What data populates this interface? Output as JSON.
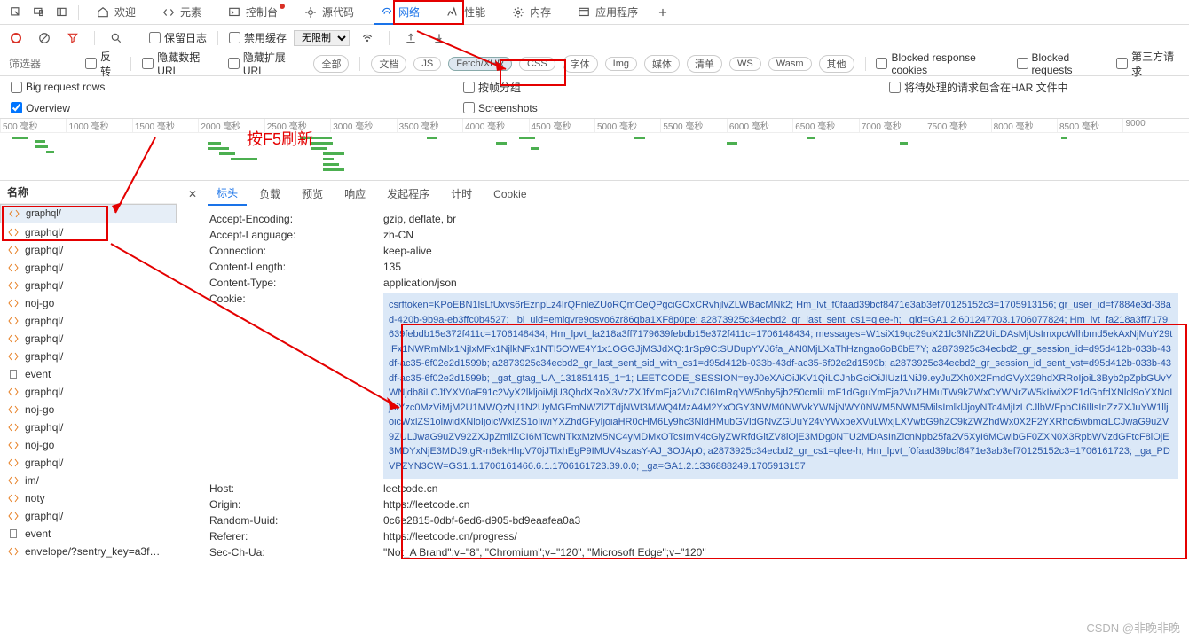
{
  "top_tabs": {
    "welcome": "欢迎",
    "elements": "元素",
    "console": "控制台",
    "sources": "源代码",
    "network": "网络",
    "performance": "性能",
    "memory": "内存",
    "application": "应用程序"
  },
  "toolbar2": {
    "preserve_log": "保留日志",
    "disable_cache": "禁用缓存",
    "throttle": "无限制"
  },
  "filter": {
    "placeholder": "筛选器",
    "invert": "反转",
    "hide_data_urls": "隐藏数据 URL",
    "hide_ext_urls": "隐藏扩展 URL",
    "pills": {
      "all": "全部",
      "doc": "文档",
      "js": "JS",
      "fetch": "Fetch/XHR",
      "css": "CSS",
      "font": "字体",
      "img": "Img",
      "media": "媒体",
      "manifest": "清单",
      "ws": "WS",
      "wasm": "Wasm",
      "other": "其他"
    },
    "blocked_cookies": "Blocked response cookies",
    "blocked_requests": "Blocked requests",
    "third_party": "第三方请求"
  },
  "options": {
    "big_rows": "Big request rows",
    "frame_group": "按帧分组",
    "overview": "Overview",
    "screenshots": "Screenshots",
    "har_pending": "将待处理的请求包含在HAR 文件中"
  },
  "timeline_ticks": [
    "500 毫秒",
    "1000 毫秒",
    "1500 毫秒",
    "2000 毫秒",
    "2500 毫秒",
    "3000 毫秒",
    "3500 毫秒",
    "4000 毫秒",
    "4500 毫秒",
    "5000 毫秒",
    "5500 毫秒",
    "6000 毫秒",
    "6500 毫秒",
    "7000 毫秒",
    "7500 毫秒",
    "8000 毫秒",
    "8500 毫秒",
    "9000"
  ],
  "req_list": {
    "header": "名称",
    "items": [
      {
        "label": "graphql/",
        "type": "xhr"
      },
      {
        "label": "graphql/",
        "type": "xhr"
      },
      {
        "label": "graphql/",
        "type": "xhr"
      },
      {
        "label": "graphql/",
        "type": "xhr"
      },
      {
        "label": "graphql/",
        "type": "xhr"
      },
      {
        "label": "noj-go",
        "type": "xhr"
      },
      {
        "label": "graphql/",
        "type": "xhr"
      },
      {
        "label": "graphql/",
        "type": "xhr"
      },
      {
        "label": "graphql/",
        "type": "xhr"
      },
      {
        "label": "event",
        "type": "doc"
      },
      {
        "label": "graphql/",
        "type": "xhr"
      },
      {
        "label": "noj-go",
        "type": "xhr"
      },
      {
        "label": "graphql/",
        "type": "xhr"
      },
      {
        "label": "noj-go",
        "type": "xhr"
      },
      {
        "label": "graphql/",
        "type": "xhr"
      },
      {
        "label": "im/",
        "type": "xhr"
      },
      {
        "label": "noty",
        "type": "xhr"
      },
      {
        "label": "graphql/",
        "type": "xhr"
      },
      {
        "label": "event",
        "type": "doc"
      },
      {
        "label": "envelope/?sentry_key=a3f…",
        "type": "xhr"
      }
    ]
  },
  "detail_tabs": {
    "headers": "标头",
    "payload": "负载",
    "preview": "预览",
    "response": "响应",
    "initiator": "发起程序",
    "timing": "计时",
    "cookies": "Cookie"
  },
  "headers": [
    {
      "k": "Accept-Encoding:",
      "v": "gzip, deflate, br"
    },
    {
      "k": "Accept-Language:",
      "v": "zh-CN"
    },
    {
      "k": "Connection:",
      "v": "keep-alive"
    },
    {
      "k": "Content-Length:",
      "v": "135"
    },
    {
      "k": "Content-Type:",
      "v": "application/json"
    },
    {
      "k": "Cookie:",
      "v": ""
    },
    {
      "k": "Host:",
      "v": "leetcode.cn"
    },
    {
      "k": "Origin:",
      "v": "https://leetcode.cn"
    },
    {
      "k": "Random-Uuid:",
      "v": "0c6e2815-0dbf-6ed6-d905-bd9eaafea0a3"
    },
    {
      "k": "Referer:",
      "v": "https://leetcode.cn/progress/"
    },
    {
      "k": "Sec-Ch-Ua:",
      "v": "\"Not_A Brand\";v=\"8\", \"Chromium\";v=\"120\", \"Microsoft Edge\";v=\"120\""
    }
  ],
  "cookie_value": "csrftoken=KPoEBN1lsLfUxvs6rEznpLz4IrQFnleZUoRQmOeQPgciGOxCRvhjlvZLWBacMNk2; Hm_lvt_f0faad39bcf8471e3ab3ef70125152c3=1705913156; gr_user_id=f7884e3d-38ad-420b-9b9a-eb3ffc0b4527; _bl_uid=emlgvre9osvo6zr86qba1XF8p0pe; a2873925c34ecbd2_gr_last_sent_cs1=qlee-h; _gid=GA1.2.601247703.1706077824; Hm_lvt_fa218a3ff7179639febdb15e372f411c=1706148434; Hm_lpvt_fa218a3ff7179639febdb15e372f411c=1706148434; messages=W1siX19qc29uX21lc3NhZ2UiLDAsMjUsImxpcWlhbmd5ekAxNjMuY29tIFx1NWRmMlx1NjIxMFx1NjlkNFx1NTI5OWE4Y1x1OGGJjMSJdXQ:1rSp9C:SUDupYVJ6fa_AN0MjLXaThHzngao6oB6bE7Y; a2873925c34ecbd2_gr_session_id=d95d412b-033b-43df-ac35-6f02e2d1599b; a2873925c34ecbd2_gr_last_sent_sid_with_cs1=d95d412b-033b-43df-ac35-6f02e2d1599b; a2873925c34ecbd2_gr_session_id_sent_vst=d95d412b-033b-43df-ac35-6f02e2d1599b; _gat_gtag_UA_131851415_1=1; LEETCODE_SESSION=eyJ0eXAiOiJKV1QiLCJhbGciOiJIUzI1NiJ9.eyJuZXh0X2FmdGVyX29hdXRRoIjoiL3Byb2pZpbGUvYWNjdb8iLCJfYXV0aF91c2VyX2lkljoiMjU3QhdXRoX3VzZXJfYmFja2VuZCI6ImRqYW5nby5jb250cmliLmF1dGguYmFja2VuZHMuTW9kZWxCYWNrZW5kIiwiX2F1dGhfdXNlcl9oYXNoIjoiYzc0MzViMjM2U1MWQzNjI1N2UyMGFmNWZlZTdjNWI3MWQ4MzA4M2YxOGY3NWM0NWVkYWNjNWY0NWM5NWM5MilsImlklJjoyNTc4MjIzLCJlbWFpbCI6IlIsInZzZXJuYW1lljoicWxlZS1oliwidXNloIjoicWxlZS1oIiwiYXZhdGFyIjoiaHR0cHM6Ly9hc3NldHMubGVldGNvZGUuY24vYWxpeXVuLWxjLXVwbG9hZC9kZWZhdWx0X2F2YXRhci5wbmciLCJwaG9uZV9ZULJwaG9uZV92ZXJpZmllZCI6MTcwNTkxMzM5NC4yMDMxOTcsImV4cGlyZWRfdGltZV8iOjE3MDg0NTU2MDAsInZlcnNpb25fa2V5XyI6MCwibGF0ZXN0X3RpbWVzdGFtcF8iOjE3MDYxNjE3MDJ9.gR-n8ekHhpV70jJTlxhEgP9IMUV4szasY-AJ_3OJAp0; a2873925c34ecbd2_gr_cs1=qlee-h; Hm_lpvt_f0faad39bcf8471e3ab3ef70125152c3=1706161723; _ga_PDVPZYN3CW=GS1.1.1706161466.6.1.1706161723.39.0.0; _ga=GA1.2.1336888249.1705913157",
  "annotations": {
    "refresh": "按F5刷新"
  },
  "watermark": "CSDN @非晚非晚"
}
